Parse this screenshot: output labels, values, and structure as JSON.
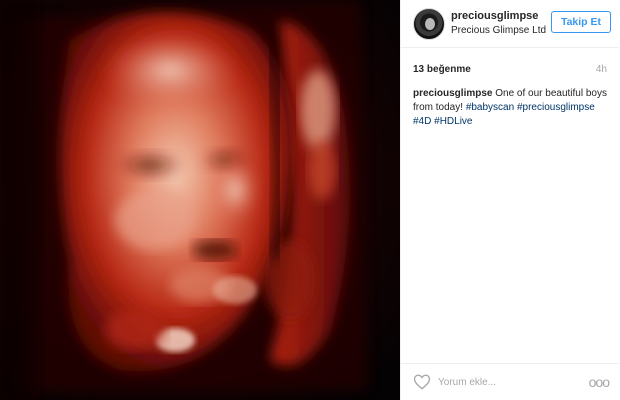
{
  "post": {
    "image_alt_icon": "ultrasound-photo",
    "author": {
      "username": "preciousglimpse",
      "full_name": "Precious Glimpse Ltd",
      "avatar_icon": "avatar-icon"
    },
    "follow_label": "Takip Et",
    "likes": "13 beğenme",
    "time": "4h",
    "caption": {
      "username": "preciousglimpse",
      "text": " One of our beautiful boys from today! ",
      "tags": [
        "#babyscan",
        "#preciousglimpse",
        "#4D",
        "#HDLive"
      ]
    },
    "comment_placeholder": "Yorum ekle...",
    "more_label": "ooo"
  },
  "colors": {
    "accent": "#3897f0",
    "hashtag": "#003569",
    "muted": "#a5a7aa",
    "text": "#262626"
  }
}
